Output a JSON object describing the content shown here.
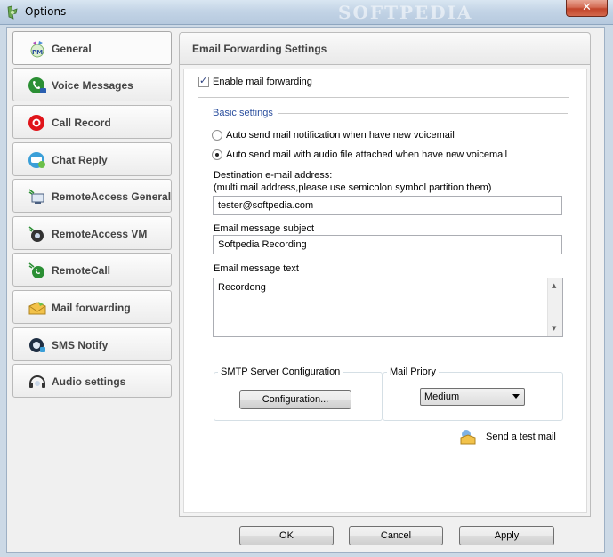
{
  "window": {
    "title": "Options",
    "watermark": "SOFTPEDIA",
    "close_glyph": "✕"
  },
  "sidebar": {
    "items": [
      {
        "label": "General",
        "icon": "pm-icon",
        "active": true
      },
      {
        "label": "Voice Messages",
        "icon": "voice-messages-icon"
      },
      {
        "label": "Call Record",
        "icon": "record-icon"
      },
      {
        "label": "Chat Reply",
        "icon": "chat-icon"
      },
      {
        "label": "RemoteAccess General",
        "icon": "remote-access-icon"
      },
      {
        "label": "RemoteAccess VM",
        "icon": "remote-vm-icon"
      },
      {
        "label": "RemoteCall",
        "icon": "remote-call-icon"
      },
      {
        "label": "Mail forwarding",
        "icon": "mail-icon"
      },
      {
        "label": "SMS Notify",
        "icon": "sms-icon"
      },
      {
        "label": "Audio settings",
        "icon": "headset-icon"
      }
    ]
  },
  "panel": {
    "title": "Email Forwarding Settings",
    "enable_label": "Enable mail forwarding",
    "basic_settings": "Basic settings",
    "radio_notification": "Auto send mail notification when have new voicemail",
    "radio_audio": "Auto send mail with audio file attached when have new voicemail",
    "destination_label": "Destination e-mail address:",
    "destination_hint": "(multi mail address,please use semicolon symbol partition them)",
    "destination_value": "tester@softpedia.com",
    "subject_label": "Email message subject",
    "subject_value": "Softpedia Recording",
    "text_label": "Email message text",
    "text_value": "Recordong",
    "smtp_group": "SMTP Server Configuration",
    "configuration_button": "Configuration...",
    "priority_group": "Mail Priory",
    "priority_value": "Medium",
    "test_mail": "Send a test mail"
  },
  "footer": {
    "ok": "OK",
    "cancel": "Cancel",
    "apply": "Apply"
  },
  "colors": {
    "section_heading": "#2b4f9e",
    "record_red": "#e0141a",
    "phone_green": "#2b9a2f"
  }
}
